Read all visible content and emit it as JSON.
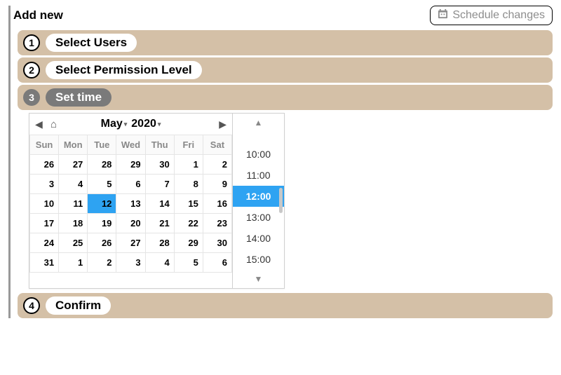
{
  "header": {
    "title": "Add new",
    "schedule_btn": "Schedule changes"
  },
  "steps": [
    {
      "num": "1",
      "label": "Select Users"
    },
    {
      "num": "2",
      "label": "Select Permission Level"
    },
    {
      "num": "3",
      "label": "Set time"
    },
    {
      "num": "4",
      "label": "Confirm"
    }
  ],
  "calendar": {
    "month": "May",
    "year": "2020",
    "day_headers": [
      "Sun",
      "Mon",
      "Tue",
      "Wed",
      "Thu",
      "Fri",
      "Sat"
    ],
    "weeks": [
      [
        {
          "d": "26",
          "o": true
        },
        {
          "d": "27",
          "o": true
        },
        {
          "d": "28",
          "o": true
        },
        {
          "d": "29",
          "o": true
        },
        {
          "d": "30",
          "o": true
        },
        {
          "d": "1"
        },
        {
          "d": "2"
        }
      ],
      [
        {
          "d": "3"
        },
        {
          "d": "4"
        },
        {
          "d": "5"
        },
        {
          "d": "6"
        },
        {
          "d": "7"
        },
        {
          "d": "8"
        },
        {
          "d": "9"
        }
      ],
      [
        {
          "d": "10"
        },
        {
          "d": "11"
        },
        {
          "d": "12",
          "sel": true
        },
        {
          "d": "13"
        },
        {
          "d": "14"
        },
        {
          "d": "15"
        },
        {
          "d": "16"
        }
      ],
      [
        {
          "d": "17"
        },
        {
          "d": "18"
        },
        {
          "d": "19"
        },
        {
          "d": "20"
        },
        {
          "d": "21"
        },
        {
          "d": "22"
        },
        {
          "d": "23"
        }
      ],
      [
        {
          "d": "24"
        },
        {
          "d": "25"
        },
        {
          "d": "26"
        },
        {
          "d": "27"
        },
        {
          "d": "28"
        },
        {
          "d": "29"
        },
        {
          "d": "30"
        }
      ],
      [
        {
          "d": "31"
        },
        {
          "d": "1",
          "o": true
        },
        {
          "d": "2",
          "o": true
        },
        {
          "d": "3",
          "o": true
        },
        {
          "d": "4",
          "o": true
        },
        {
          "d": "5",
          "o": true
        },
        {
          "d": "6",
          "o": true
        }
      ]
    ]
  },
  "times": {
    "items": [
      "10:00",
      "11:00",
      "12:00",
      "13:00",
      "14:00",
      "15:00"
    ],
    "selected": "12:00"
  }
}
